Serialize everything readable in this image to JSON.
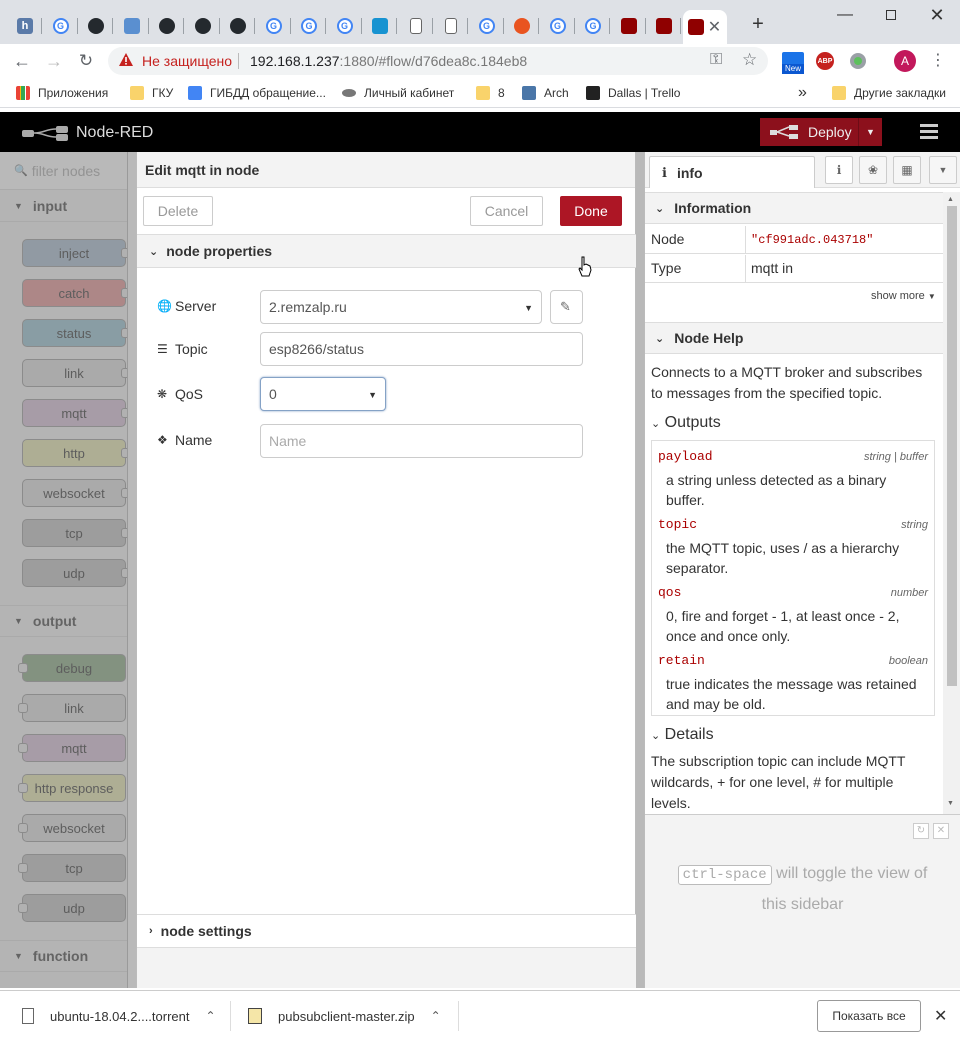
{
  "browser": {
    "tabs": [
      {
        "icon": "h",
        "color": "#5a7aa8"
      },
      {
        "icon": "G",
        "color": "#4285f4"
      },
      {
        "icon": "github",
        "color": "#24292e"
      },
      {
        "icon": "globe",
        "color": "#5a8fd0"
      },
      {
        "icon": "github",
        "color": "#24292e"
      },
      {
        "icon": "github",
        "color": "#24292e"
      },
      {
        "icon": "github",
        "color": "#24292e"
      },
      {
        "icon": "G",
        "color": "#4285f4"
      },
      {
        "icon": "G",
        "color": "#4285f4"
      },
      {
        "icon": "G",
        "color": "#4285f4"
      },
      {
        "icon": "arch",
        "color": "#1793d1"
      },
      {
        "icon": "doc",
        "color": "#666"
      },
      {
        "icon": "doc",
        "color": "#666"
      },
      {
        "icon": "G",
        "color": "#4285f4"
      },
      {
        "icon": "ubuntu",
        "color": "#e95420"
      },
      {
        "icon": "G",
        "color": "#4285f4"
      },
      {
        "icon": "G",
        "color": "#4285f4"
      },
      {
        "icon": "node-red",
        "color": "#8f0000"
      },
      {
        "icon": "node-red",
        "color": "#8f0000"
      },
      {
        "icon": "node-red",
        "color": "#8f0000",
        "active": true
      }
    ],
    "security_label": "Не защищено",
    "url_host": "192.168.1.237",
    "url_rest": ":1880/#flow/d76dea8c.184eb8",
    "new_badge": "New",
    "abp_badge": "ABP",
    "profile_initial": "A",
    "bookmarks": [
      {
        "label": "Приложения",
        "icon": "apps-icon"
      },
      {
        "label": "ГКУ",
        "icon": "folder-icon"
      },
      {
        "label": "ГИБДД обращение...",
        "icon": "doc-icon"
      },
      {
        "label": "Личный кабинет",
        "icon": "car-icon"
      },
      {
        "label": "8",
        "icon": "folder-icon"
      },
      {
        "label": "Arch",
        "icon": "vk-icon"
      },
      {
        "label": "Dallas | Trello",
        "icon": "trello-icon"
      }
    ],
    "bookmarks_more": "»",
    "other_bookmarks": "Другие закладки"
  },
  "app": {
    "title": "Node-RED",
    "deploy_label": "Deploy",
    "menu_icon": "hamburger-icon"
  },
  "palette": {
    "filter_placeholder": "filter nodes",
    "categories": {
      "input": "input",
      "output": "output",
      "function": "function"
    },
    "input_nodes": [
      "inject",
      "catch",
      "status",
      "link",
      "mqtt",
      "http",
      "websocket",
      "tcp",
      "udp"
    ],
    "output_nodes": [
      "debug",
      "link",
      "mqtt",
      "http response",
      "websocket",
      "tcp",
      "udp"
    ],
    "colors": {
      "inject": "#a6bbcf",
      "catch": "#e49191",
      "status": "#94c1d0",
      "link": "#dddddd",
      "mqtt": "#d8bfd8",
      "http": "#e7e7ae",
      "websocket": "#dddddd",
      "tcp": "#c0c0c0",
      "udp": "#c0c0c0",
      "debug": "#87a980"
    }
  },
  "editor": {
    "title": "Edit mqtt in node",
    "delete_label": "Delete",
    "cancel_label": "Cancel",
    "done_label": "Done",
    "properties_section": "node properties",
    "settings_section": "node settings",
    "fields": {
      "server_label": "Server",
      "server_value": "2.remzalp.ru",
      "topic_label": "Topic",
      "topic_value": "esp8266/status",
      "qos_label": "QoS",
      "qos_value": "0",
      "name_label": "Name",
      "name_placeholder": "Name"
    }
  },
  "sidebar": {
    "tab_label": "info",
    "info_section": "Information",
    "rows": [
      {
        "key": "Node",
        "value": "\"cf991adc.043718\""
      },
      {
        "key": "Type",
        "value": "mqtt in"
      }
    ],
    "show_more": "show more",
    "help_section": "Node Help",
    "help_intro": "Connects to a MQTT broker and subscribes to messages from the specified topic.",
    "outputs_title": "Outputs",
    "outputs": [
      {
        "name": "payload",
        "type": "string | buffer",
        "desc": "a string unless detected as a binary buffer."
      },
      {
        "name": "topic",
        "type": "string",
        "desc": "the MQTT topic, uses / as a hierarchy separator."
      },
      {
        "name": "qos",
        "type": "number",
        "desc": "0, fire and forget - 1, at least once - 2, once and once only."
      },
      {
        "name": "retain",
        "type": "boolean",
        "desc": "true indicates the message was retained and may be old."
      }
    ],
    "details_title": "Details",
    "details_text": "The subscription topic can include MQTT wildcards, + for one level, # for multiple levels.",
    "shortcut_key": "ctrl-space",
    "shortcut_text_1": "will toggle the view of",
    "shortcut_text_2": "this sidebar"
  },
  "downloads": {
    "items": [
      {
        "name": "ubuntu-18.04.2....torrent",
        "icon": "file-icon"
      },
      {
        "name": "pubsubclient-master.zip",
        "icon": "zip-icon"
      }
    ],
    "show_all": "Показать все"
  }
}
